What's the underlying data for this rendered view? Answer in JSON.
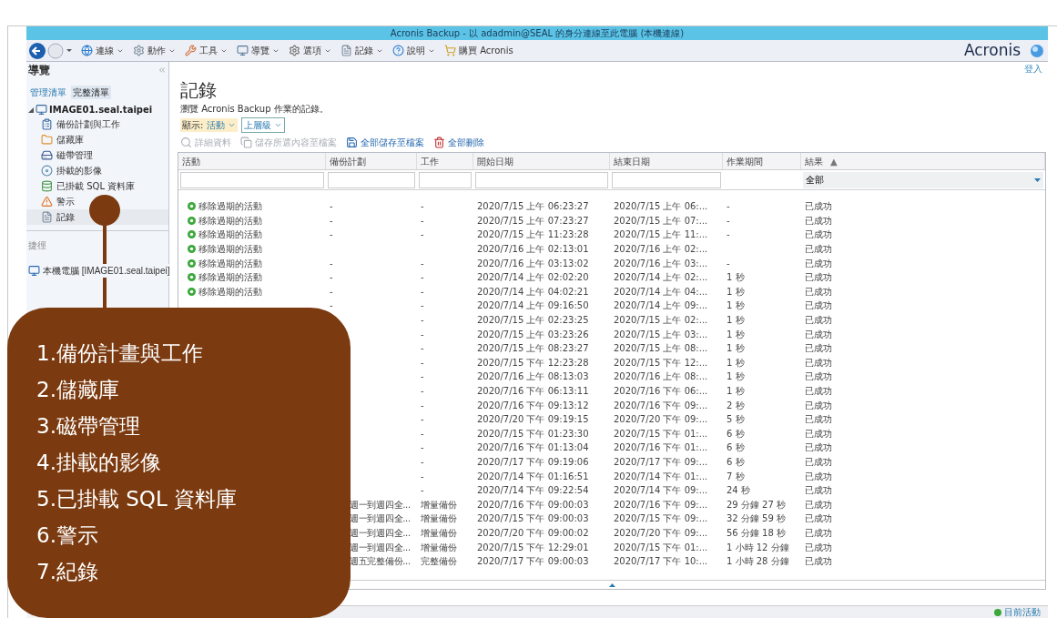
{
  "window": {
    "title": "Acronis Backup - 以 adadmin@SEAL 的身分連線至此電腦 (本機連線)"
  },
  "menu": [
    {
      "label": "連線"
    },
    {
      "label": "動作"
    },
    {
      "label": "工具"
    },
    {
      "label": "導覽"
    },
    {
      "label": "選項"
    },
    {
      "label": "記錄"
    },
    {
      "label": "說明"
    }
  ],
  "buy_link": "購買 Acronis",
  "brand": "Acronis",
  "login_link": "登入",
  "sidebar": {
    "title": "導覽",
    "tabs": [
      {
        "label": "管理清單",
        "selected": false
      },
      {
        "label": "完整清單",
        "selected": true
      }
    ],
    "tree": {
      "label": "IMAGE01.seal.taipei",
      "expanded": true,
      "children": [
        {
          "label": "備份計劃與工作",
          "kind": "plan",
          "selected": false
        },
        {
          "label": "儲藏庫",
          "kind": "vault",
          "selected": false
        },
        {
          "label": "磁帶管理",
          "kind": "tape",
          "selected": false
        },
        {
          "label": "掛載的影像",
          "kind": "image",
          "selected": false
        },
        {
          "label": "已掛載 SQL 資料庫",
          "kind": "sql",
          "selected": false
        },
        {
          "label": "警示",
          "kind": "alert",
          "selected": false
        },
        {
          "label": "記錄",
          "kind": "log",
          "selected": true
        }
      ]
    },
    "shortcuts_title": "捷徑",
    "shortcuts": [
      {
        "label": "本機電腦 [IMAGE01.seal.taipei]"
      }
    ]
  },
  "page": {
    "title": "記錄",
    "subtitle": "瀏覽 Acronis Backup 作業的記錄。",
    "show_label": "顯示:",
    "show_value": "活動",
    "level_value": "上層級"
  },
  "actions": [
    {
      "label": "詳細資料",
      "disabled": true
    },
    {
      "label": "儲存所選內容至檔案",
      "disabled": true
    },
    {
      "label": "全部儲存至檔案",
      "disabled": false
    },
    {
      "label": "全部刪除",
      "disabled": false
    }
  ],
  "table": {
    "columns": [
      "活動",
      "備份計劃",
      "工作",
      "開始日期",
      "結束日期",
      "作業期間",
      "結果"
    ],
    "sort_mark": "▲",
    "result_filter": "全部",
    "rows": [
      {
        "activity": "移除過期的活動",
        "plan": "-",
        "job": "-",
        "start": "2020/7/15 上午 06:23:27",
        "end": "2020/7/15 上午 06:...",
        "duration": "-",
        "result": "已成功"
      },
      {
        "activity": "移除過期的活動",
        "plan": "-",
        "job": "-",
        "start": "2020/7/15 上午 07:23:27",
        "end": "2020/7/15 上午 07:...",
        "duration": "-",
        "result": "已成功"
      },
      {
        "activity": "移除過期的活動",
        "plan": "-",
        "job": "-",
        "start": "2020/7/15 上午 11:23:28",
        "end": "2020/7/15 上午 11:...",
        "duration": "-",
        "result": "已成功"
      },
      {
        "activity": "移除過期的活動",
        "start": "2020/7/16 上午 02:13:01",
        "end": "2020/7/16 上午 02:...",
        "result": "已成功"
      },
      {
        "activity": "移除過期的活動",
        "plan": "-",
        "job": "-",
        "start": "2020/7/16 上午 03:13:02",
        "end": "2020/7/16 上午 03:...",
        "duration": "-",
        "result": "已成功"
      },
      {
        "activity": "移除過期的活動",
        "plan": "-",
        "job": "-",
        "start": "2020/7/14 上午 02:02:20",
        "end": "2020/7/14 上午 02:...",
        "duration": "1 秒",
        "result": "已成功"
      },
      {
        "activity": "移除過期的活動",
        "plan": "-",
        "job": "-",
        "start": "2020/7/14 上午 04:02:21",
        "end": "2020/7/14 上午 04:...",
        "duration": "1 秒",
        "result": "已成功"
      },
      {
        "plan": "-",
        "job": "-",
        "start": "2020/7/14 上午 09:16:50",
        "end": "2020/7/14 上午 09:...",
        "duration": "1 秒",
        "result": "已成功"
      },
      {
        "job": "-",
        "start": "2020/7/15 上午 02:23:25",
        "end": "2020/7/15 上午 02:...",
        "duration": "1 秒",
        "result": "已成功"
      },
      {
        "job": "-",
        "start": "2020/7/15 上午 03:23:26",
        "end": "2020/7/15 上午 03:...",
        "duration": "1 秒",
        "result": "已成功"
      },
      {
        "job": "-",
        "start": "2020/7/15 上午 08:23:27",
        "end": "2020/7/15 上午 08:...",
        "duration": "1 秒",
        "result": "已成功"
      },
      {
        "job": "-",
        "start": "2020/7/15 下午 12:23:28",
        "end": "2020/7/15 下午 12:...",
        "duration": "1 秒",
        "result": "已成功"
      },
      {
        "job": "-",
        "start": "2020/7/16 上午 08:13:03",
        "end": "2020/7/16 上午 08:...",
        "duration": "1 秒",
        "result": "已成功"
      },
      {
        "job": "-",
        "start": "2020/7/16 下午 06:13:11",
        "end": "2020/7/16 下午 06:...",
        "duration": "1 秒",
        "result": "已成功"
      },
      {
        "job": "-",
        "start": "2020/7/16 下午 09:13:12",
        "end": "2020/7/16 下午 09:...",
        "duration": "2 秒",
        "result": "已成功"
      },
      {
        "job": "-",
        "start": "2020/7/20 下午 09:19:15",
        "end": "2020/7/20 下午 09:...",
        "duration": "5 秒",
        "result": "已成功"
      },
      {
        "job": "-",
        "start": "2020/7/15 下午 01:23:30",
        "end": "2020/7/15 下午 01:...",
        "duration": "6 秒",
        "result": "已成功"
      },
      {
        "job": "-",
        "start": "2020/7/16 下午 01:13:04",
        "end": "2020/7/16 下午 01:...",
        "duration": "6 秒",
        "result": "已成功"
      },
      {
        "job": "-",
        "start": "2020/7/17 下午 09:19:06",
        "end": "2020/7/17 下午 09:...",
        "duration": "6 秒",
        "result": "已成功"
      },
      {
        "job": "-",
        "start": "2020/7/14 下午 01:16:51",
        "end": "2020/7/14 下午 01:...",
        "duration": "7 秒",
        "result": "已成功"
      },
      {
        "job": "-",
        "start": "2020/7/14 下午 09:22:54",
        "end": "2020/7/14 下午 09:...",
        "duration": "24 秒",
        "result": "已成功"
      },
      {
        "plan": "週一到週四全...",
        "job": "增量備份",
        "start": "2020/7/16 下午 09:00:03",
        "end": "2020/7/16 下午 09:...",
        "duration": "29 分鐘 27 秒",
        "result": "已成功"
      },
      {
        "plan": "週一到週四全...",
        "job": "增量備份",
        "start": "2020/7/15 下午 09:00:03",
        "end": "2020/7/15 下午 09:...",
        "duration": "32 分鐘 59 秒",
        "result": "已成功"
      },
      {
        "plan": "週一到週四全...",
        "job": "增量備份",
        "start": "2020/7/20 下午 09:00:02",
        "end": "2020/7/20 下午 09:...",
        "duration": "56 分鐘 18 秒",
        "result": "已成功"
      },
      {
        "plan": "週一到週四全...",
        "job": "增量備份",
        "start": "2020/7/15 下午 12:29:01",
        "end": "2020/7/15 下午 01:...",
        "duration": "1 小時 12 分鐘",
        "result": "已成功"
      },
      {
        "plan": "週五完整備份...",
        "job": "完整備份",
        "start": "2020/7/17 下午 09:00:03",
        "end": "2020/7/17 下午 10:...",
        "duration": "1 小時 28 分鐘",
        "result": "已成功"
      }
    ]
  },
  "status_bar": {
    "current_activity": "目前活動"
  },
  "callout": {
    "items": [
      "1.備份計畫與工作",
      "2.儲藏庫",
      "3.磁帶管理",
      "4.掛載的影像",
      "5.已掛載 SQL 資料庫",
      "6.警示",
      "7.紀錄"
    ]
  }
}
